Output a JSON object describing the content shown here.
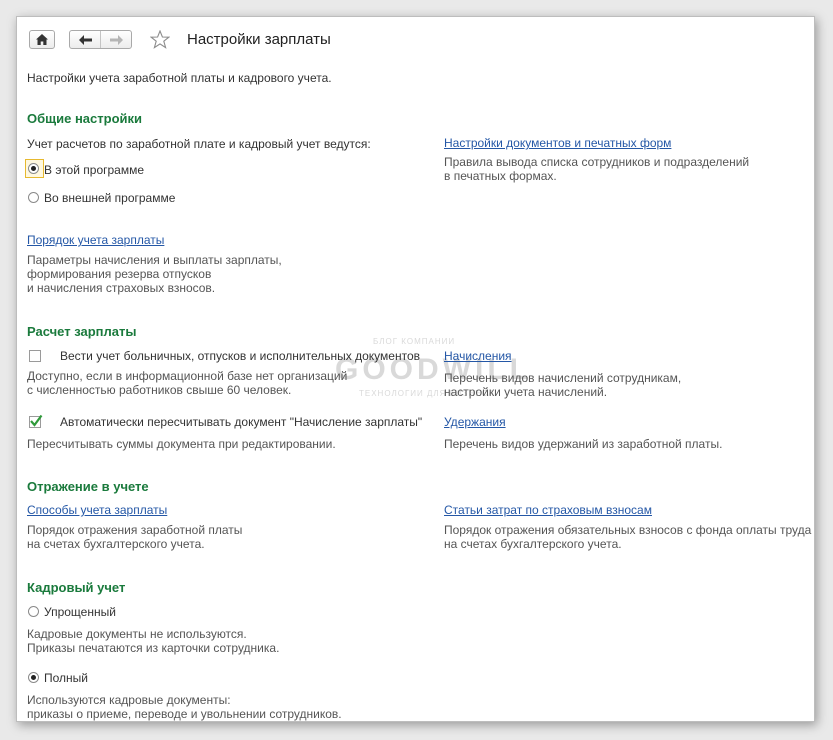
{
  "window": {
    "title": "Настройки зарплаты"
  },
  "toolbar": {
    "home_icon": "home-icon",
    "back_icon": "arrow-left-icon",
    "forward_icon": "arrow-right-icon",
    "star_icon": "star-icon"
  },
  "page": {
    "subtitle": "Настройки учета заработной платы и кадрового учета."
  },
  "general": {
    "heading": "Общие настройки",
    "question": "Учет расчетов по заработной плате и кадровый учет ведутся:",
    "option_this": "В этой программе",
    "option_external": "Во внешней программе",
    "selected": "option_this",
    "doc_settings_link": "Настройки документов и печатных форм",
    "doc_settings_desc_1": "Правила вывода списка сотрудников и подразделений",
    "doc_settings_desc_2": "в печатных формах.",
    "order_link": "Порядок учета зарплаты",
    "order_desc_1": "Параметры начисления и выплаты зарплаты,",
    "order_desc_2": "формирования резерва отпусков",
    "order_desc_3": "и начисления страховых взносов."
  },
  "calc": {
    "heading": "Расчет зарплаты",
    "sick_label": "Вести учет больничных, отпусков и исполнительных документов",
    "sick_checked": false,
    "sick_desc_1": "Доступно, если в информационной базе нет организаций",
    "sick_desc_2": "с численностью работников свыше 60 человек.",
    "recalc_label": "Автоматически пересчитывать документ \"Начисление зарплаты\"",
    "recalc_checked": true,
    "recalc_desc": "Пересчитывать суммы документа при редактировании.",
    "accruals_link": "Начисления",
    "accruals_desc_1": "Перечень видов начислений сотрудникам,",
    "accruals_desc_2": "настройки учета начислений.",
    "deductions_link": "Удержания",
    "deductions_desc": "Перечень видов удержаний из заработной платы."
  },
  "accounting": {
    "heading": "Отражение в учете",
    "methods_link": "Способы учета зарплаты",
    "methods_desc_1": "Порядок отражения заработной платы",
    "methods_desc_2": "на счетах бухгалтерского учета.",
    "costs_link": "Статьи затрат по страховым взносам",
    "costs_desc_1": "Порядок отражения обязательных взносов с фонда оплаты труда",
    "costs_desc_2": "на счетах бухгалтерского учета."
  },
  "hr": {
    "heading": "Кадровый учет",
    "option_simple": "Упрощенный",
    "simple_desc_1": "Кадровые документы не используются.",
    "simple_desc_2": "Приказы печатаются из карточки сотрудника.",
    "option_full": "Полный",
    "full_desc_1": "Используются кадровые документы:",
    "full_desc_2": "приказы о приеме, переводе и увольнении сотрудников.",
    "selected": "option_full"
  },
  "watermark": {
    "line1": "БЛОГ КОМПАНИИ",
    "line2": "GOODWILL",
    "line3": "ТЕХНОЛОГИИ ДЛЯ БИЗНЕСА"
  }
}
